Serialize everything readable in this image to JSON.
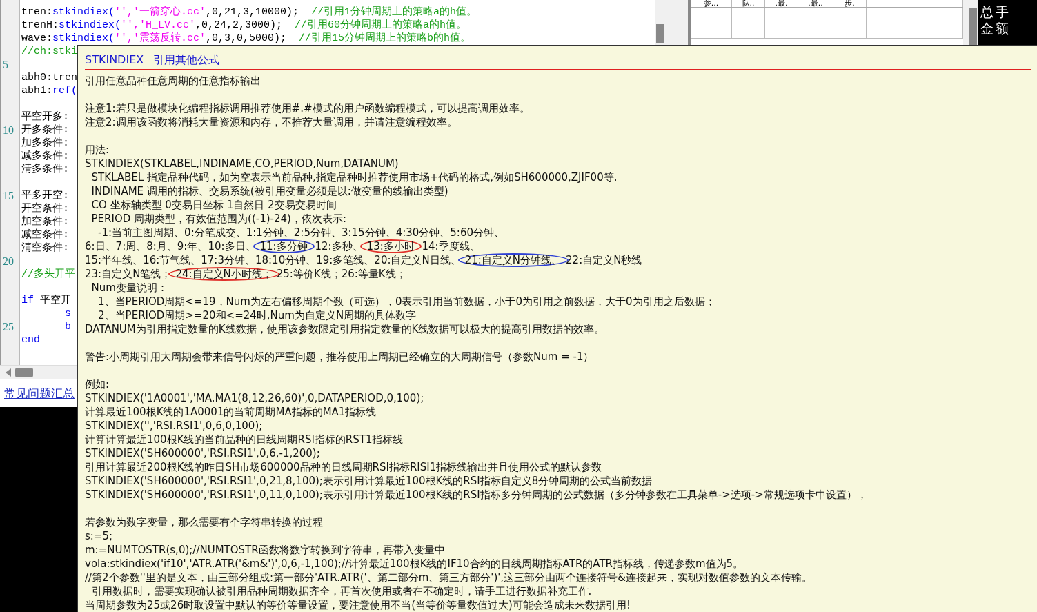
{
  "editor": {
    "lines": [
      {
        "kind": "code",
        "segments": [
          {
            "text": "tren:",
            "kind": "plain"
          },
          {
            "text": "stkindiex(",
            "kind": "func"
          },
          {
            "text": "'','一箭穿心.cc'",
            "kind": "string"
          },
          {
            "text": ",0,21,3,10000);  ",
            "kind": "plain"
          },
          {
            "text": "//引用1分钟周期上的策略a的h值。",
            "kind": "comment"
          }
        ]
      },
      {
        "kind": "code",
        "segments": [
          {
            "text": "trenH:",
            "kind": "plain"
          },
          {
            "text": "stkindiex(",
            "kind": "func"
          },
          {
            "text": "'','H_LV.cc'",
            "kind": "string"
          },
          {
            "text": ",0,24,2,3000);  ",
            "kind": "plain"
          },
          {
            "text": "//引用60分钟周期上的策略a的h值。",
            "kind": "comment"
          }
        ]
      },
      {
        "kind": "code",
        "segments": [
          {
            "text": "wave:",
            "kind": "plain"
          },
          {
            "text": "stkindiex(",
            "kind": "func"
          },
          {
            "text": "'','震荡反转.cc'",
            "kind": "string"
          },
          {
            "text": ",0,3,0,5000);  ",
            "kind": "plain"
          },
          {
            "text": "//引用15分钟周期上的策略b的h值。",
            "kind": "comment"
          }
        ]
      },
      {
        "kind": "code",
        "segments": [
          {
            "text": "//ch:stki",
            "kind": "comment"
          }
        ]
      },
      {
        "kind": "blank",
        "gutter": "5"
      },
      {
        "kind": "code",
        "segments": [
          {
            "text": "abh0:tren",
            "kind": "plain"
          }
        ]
      },
      {
        "kind": "code",
        "segments": [
          {
            "text": "abh1:",
            "kind": "plain"
          },
          {
            "text": "ref(",
            "kind": "func"
          }
        ]
      },
      {
        "kind": "blank"
      },
      {
        "kind": "code",
        "segments": [
          {
            "text": "平空开多:",
            "kind": "plain"
          }
        ]
      },
      {
        "kind": "code",
        "gutter": "10",
        "segments": [
          {
            "text": "开多条件:",
            "kind": "plain"
          }
        ]
      },
      {
        "kind": "code",
        "segments": [
          {
            "text": "加多条件:",
            "kind": "plain"
          }
        ]
      },
      {
        "kind": "code",
        "segments": [
          {
            "text": "减多条件:",
            "kind": "plain"
          }
        ]
      },
      {
        "kind": "code",
        "segments": [
          {
            "text": "清多条件:",
            "kind": "plain"
          }
        ]
      },
      {
        "kind": "blank"
      },
      {
        "kind": "code",
        "gutter": "15",
        "segments": [
          {
            "text": "平多开空:",
            "kind": "plain"
          }
        ]
      },
      {
        "kind": "code",
        "segments": [
          {
            "text": "开空条件:",
            "kind": "plain"
          }
        ]
      },
      {
        "kind": "code",
        "segments": [
          {
            "text": "加空条件:",
            "kind": "plain"
          }
        ]
      },
      {
        "kind": "code",
        "segments": [
          {
            "text": "减空条件:",
            "kind": "plain"
          }
        ]
      },
      {
        "kind": "code",
        "segments": [
          {
            "text": "清空条件:",
            "kind": "plain"
          }
        ]
      },
      {
        "kind": "blank",
        "gutter": "20"
      },
      {
        "kind": "code",
        "segments": [
          {
            "text": "//多头开平",
            "kind": "comment"
          }
        ]
      },
      {
        "kind": "blank"
      },
      {
        "kind": "code",
        "segments": [
          {
            "text": "if",
            "kind": "func"
          },
          {
            "text": " 平空开",
            "kind": "plain"
          }
        ]
      },
      {
        "kind": "code",
        "segments": [
          {
            "text": "       s",
            "kind": "func"
          }
        ]
      },
      {
        "kind": "code",
        "gutter": "25",
        "segments": [
          {
            "text": "       b",
            "kind": "func"
          }
        ]
      },
      {
        "kind": "code",
        "segments": [
          {
            "text": "end",
            "kind": "func"
          }
        ]
      }
    ],
    "link": "常见问题汇总"
  },
  "table": {
    "columns": [
      "参...",
      "队..",
      ".最.",
      ".最..",
      "步."
    ]
  },
  "side_panel": {
    "labels": [
      "总手",
      "金额"
    ]
  },
  "tooltip": {
    "name": "STKINDIEX",
    "title": "引用其他公式",
    "paragraphs": [
      [
        "引用任意品种任意周期的任意指标输出"
      ],
      [
        "注意1:若只是做模块化编程指标调用推荐使用#.#模式的用户函数编程模式，可以提高调用效率。",
        "注意2:调用该函数将消耗大量资源和内存，不推荐大量调用，并请注意编程效率。"
      ],
      [
        "用法:",
        "STKINDIEX(STKLABEL,INDINAME,CO,PERIOD,Num,DATANUM)",
        "  STKLABEL 指定品种代码，如为空表示当前品种,指定品种时推荐使用市场+代码的格式,例如SH600000,ZJIF00等.",
        "  INDINAME 调用的指标、交易系统(被引用变量必须是以:做变量的线输出类型)",
        "  CO 坐标轴类型 0交易日坐标 1自然日 2交易交易时间",
        "  PERIOD 周期类型，有效值范围为((-1)-24)，依次表示:",
        "    -1:当前主图周期、0:分笔成交、1:1分钟、2:5分钟、3:15分钟、4:30分钟、5:60分钟、",
        {
          "parts": [
            {
              "text": "6:日、7:周、8:月、9:年、10:多日、"
            },
            {
              "text": "11:多分钟",
              "color": "#2d3fd4"
            },
            {
              "text": " 12:多秒、"
            },
            {
              "text": "13:多小时",
              "color": "#e0302a"
            },
            {
              "text": " 14:季度线、"
            }
          ]
        },
        {
          "parts": [
            {
              "text": "15:半年线、16:节气线、17:3分钟、18:10分钟、19:多笔线、20:自定义N日线、"
            },
            {
              "text": "21:自定义N分钟线、",
              "color": "#2d3fd4"
            },
            {
              "text": "22:自定义N秒线"
            }
          ]
        },
        {
          "parts": [
            {
              "text": "23:自定义N笔线；"
            },
            {
              "text": "24:自定义N小时线；",
              "color": "#e0302a"
            },
            {
              "text": "25:等价K线；26:等量K线；"
            }
          ]
        },
        "  Num变量说明：",
        "    1、当PERIOD周期<=19，Num为左右偏移周期个数（可选），0表示引用当前数据，小于0为引用之前数据，大于0为引用之后数据；",
        "    2、当PERIOD周期>=20和<=24时,Num为自定义N周期的具体数字",
        "DATANUM为引用指定数量的K线数据，使用该参数限定引用指定数量的K线数据可以极大的提高引用数据的效率。"
      ],
      [
        "警告:小周期引用大周期会带来信号闪烁的严重问题，推荐使用上周期已经确立的大周期信号（参数Num = -1）"
      ],
      [
        "例如:",
        "STKINDIEX('1A0001','MA.MA1(8,12,26,60)',0,DATAPERIOD,0,100);",
        "计算最近100根K线的1A0001的当前周期MA指标的MA1指标线",
        "STKINDIEX('','RSI.RSI1',0,6,0,100);",
        "计算计算最近100根K线的当前品种的日线周期RSI指标的RST1指标线",
        "STKINDIEX('SH600000','RSI.RSI1',0,6,-1,200);",
        "引用计算最近200根K线的昨日SH市场600000品种的日线周期RSI指标RISI1指标线输出并且使用公式的默认参数",
        "STKINDIEX('SH600000','RSI.RSI1',0,21,8,100);表示引用计算最近100根K线的RSI指标自定义8分钟周期的公式当前数据",
        "STKINDIEX('SH600000','RSI.RSI1',0,11,0,100);表示引用计算最近100根K线的RSI指标多分钟周期的公式数据（多分钟参数在工具菜单->选项->常规选项卡中设置），"
      ],
      [
        "若参数为数字变量，那么需要有个字符串转换的过程",
        "s:=5;",
        "m:=NUMTOSTR(s,0);//NUMTOSTR函数将数字转换到字符串，再带入变量中",
        "vola:stkindiex('if10','ATR.ATR('&m&')',0,6,-1,100);//计算最近100根K线的IF10合约的日线周期指标ATR的ATR指标线，传递参数m值为5。",
        "//第2个参数''里的是文本，由三部分组成:第一部分'ATR.ATR('、第二部分m、第三方部分')',这三部分由两个连接符号&连接起来，实现对数值参数的文本传输。",
        "  引用数据时，需要实现确认被引用品种周期数据齐全，再首次使用或者在不确定时，请手工进行数据补充工作.",
        "当周期参数为25或26时取设置中默认的等价等量设置，要注意使用不当(当等价等量数值过大)可能会造成未来数据引用!"
      ]
    ]
  }
}
